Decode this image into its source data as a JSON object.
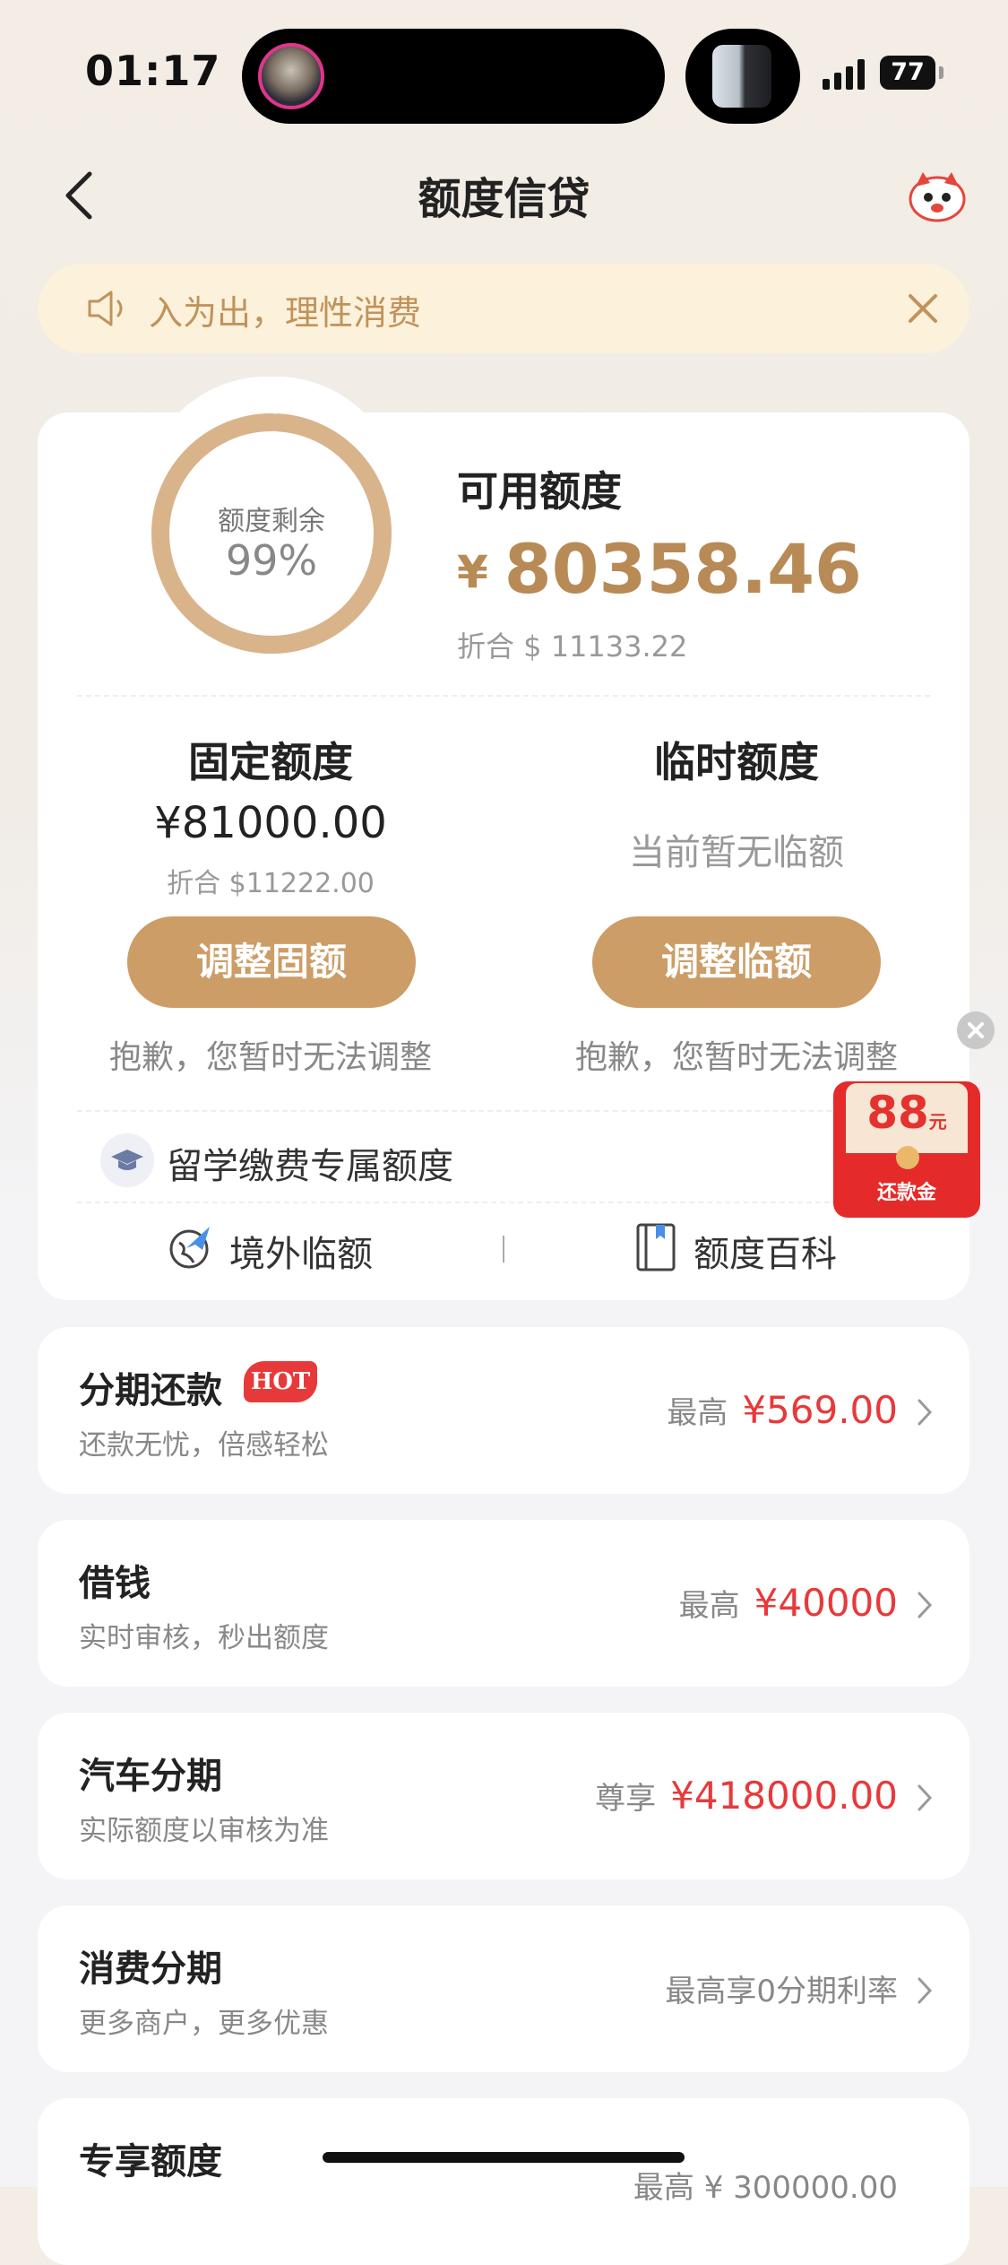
{
  "status_bar": {
    "time": "01:17",
    "battery": "77"
  },
  "nav": {
    "title": "额度信贷"
  },
  "notice": {
    "text": "入为出，理性消费"
  },
  "credit": {
    "ring_label": "额度剩余",
    "ring_percent": "99%",
    "remaining_fraction": 0.99,
    "available_label": "可用额度",
    "currency": "¥",
    "available_amount": "80358.46",
    "available_usd": "折合 $ 11133.22",
    "fixed": {
      "title": "固定额度",
      "amount": "¥81000.00",
      "usd": "折合 $11222.00",
      "button": "调整固额",
      "note": "抱歉，您暂时无法调整"
    },
    "temporary": {
      "title": "临时额度",
      "status": "当前暂无临额",
      "button": "调整临额",
      "note": "抱歉，您暂时无法调整"
    },
    "study_abroad": "留学缴费专属额度",
    "overseas_temp": "境外临额",
    "credit_wiki": "额度百科"
  },
  "red_packet": {
    "amount": "88",
    "unit": "元",
    "label": "还款金"
  },
  "products": [
    {
      "title": "分期还款",
      "badge": "HOT",
      "subtitle": "还款无忧，倍感轻松",
      "prefix": "最高",
      "value": "¥569.00"
    },
    {
      "title": "借钱",
      "subtitle": "实时审核，秒出额度",
      "prefix": "最高",
      "value": "¥40000"
    },
    {
      "title": "汽车分期",
      "subtitle": "实际额度以审核为准",
      "prefix": "尊享",
      "value": "¥418000.00"
    },
    {
      "title": "消费分期",
      "subtitle": "更多商户，更多优惠",
      "text": "最高享0分期利率"
    },
    {
      "title": "专享额度",
      "text": "最高 ¥ 300000.00"
    }
  ],
  "colors": {
    "accent_gold": "#cc9d66",
    "price_red": "#e8393a",
    "notice_bg": "#fcf1db"
  }
}
